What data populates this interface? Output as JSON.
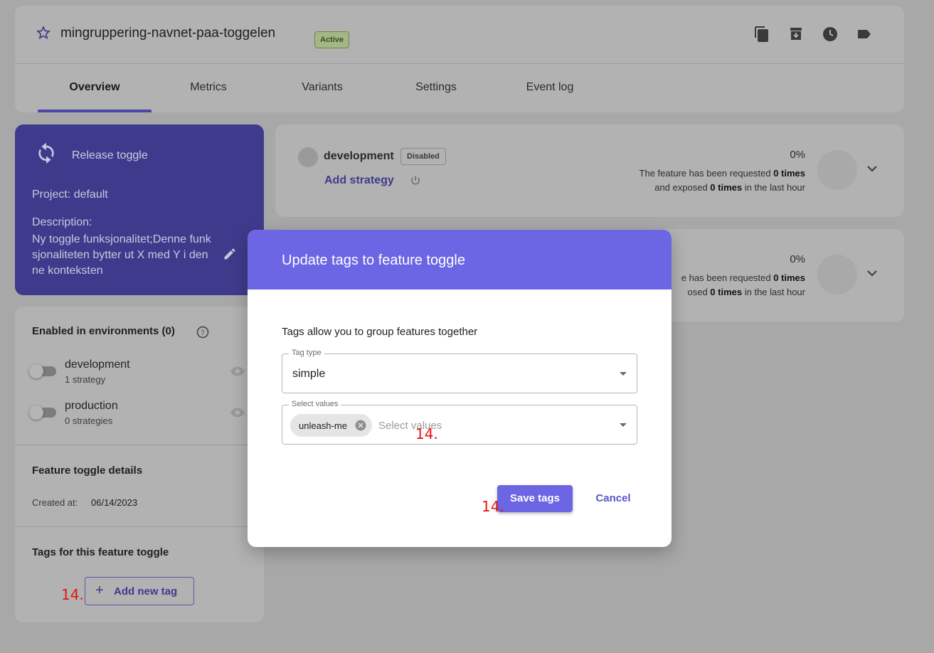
{
  "header": {
    "feature_name": "mingruppering-navnet-paa-toggelen",
    "status_badge": "Active",
    "tabs": [
      "Overview",
      "Metrics",
      "Variants",
      "Settings",
      "Event log"
    ],
    "active_tab": "Overview",
    "icons": [
      "copy-icon",
      "archive-icon",
      "history-icon",
      "tag-icon"
    ]
  },
  "release_card": {
    "title": "Release toggle",
    "project": "Project: default",
    "description_label": "Description:",
    "description": "Ny toggle funksjonalitet;Denne funksjonaliteten bytter ut X med Y i denne konteksten"
  },
  "environments_card": {
    "title": "Enabled in environments (0)",
    "environments": [
      {
        "name": "development",
        "strategies": "1 strategy"
      },
      {
        "name": "production",
        "strategies": "0 strategies"
      }
    ],
    "details_title": "Feature toggle details",
    "created_label": "Created at:",
    "created_value": "06/14/2023",
    "tags_title": "Tags for this feature toggle",
    "add_tag_label": "Add new tag"
  },
  "env_rows": [
    {
      "name": "development",
      "badge": "Disabled",
      "add_strategy": "Add strategy",
      "percent": "0%",
      "line1_pre": "The feature has been requested ",
      "line1_bold": "0 times",
      "line2_pre": "and exposed ",
      "line2_bold": "0 times",
      "line2_post": " in the last hour"
    },
    {
      "name": "production",
      "percent": "0%",
      "line1_pre": "e has been requested ",
      "line1_bold": "0 times",
      "line2_pre": "osed ",
      "line2_bold": "0 times",
      "line2_post": " in the last hour"
    }
  ],
  "modal": {
    "title": "Update tags to feature toggle",
    "hint": "Tags allow you to group features together",
    "tag_type_legend": "Tag type",
    "tag_type_value": "simple",
    "values_legend": "Select values",
    "chip": "unleash-me",
    "values_placeholder": "Select values",
    "save_label": "Save tags",
    "cancel_label": "Cancel"
  },
  "annotation_marker": "14."
}
